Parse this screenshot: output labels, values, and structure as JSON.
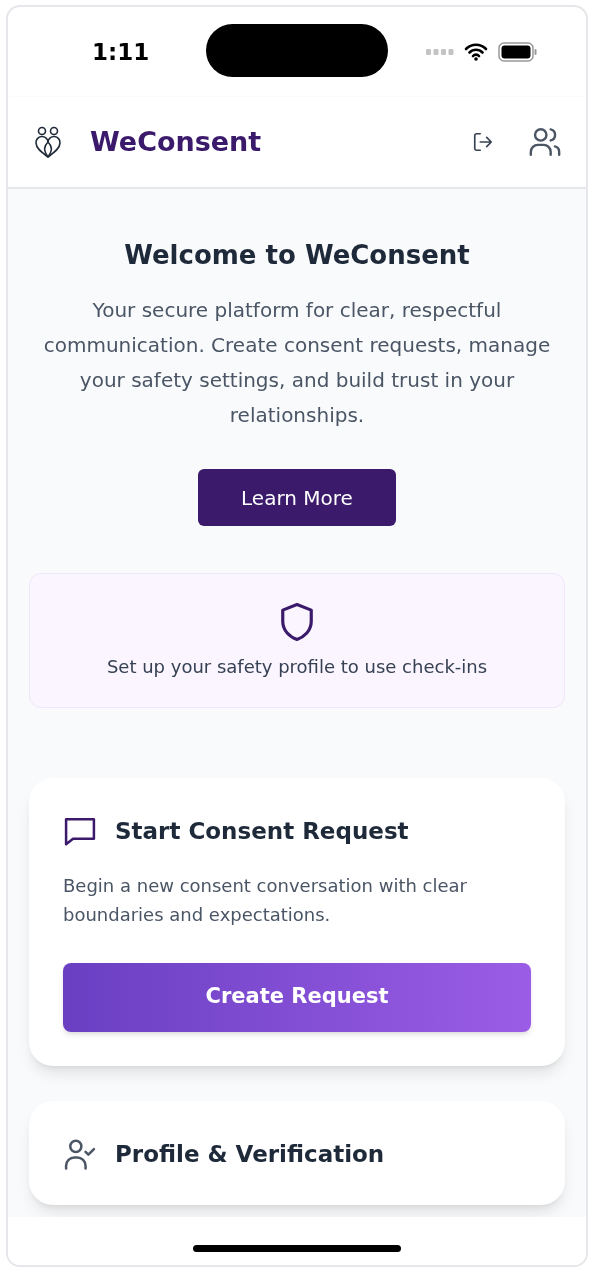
{
  "status_bar": {
    "time": "1:11"
  },
  "header": {
    "app_name": "WeConsent"
  },
  "welcome": {
    "title": "Welcome to WeConsent",
    "text": "Your secure platform for clear, respectful communication. Create consent requests, manage your safety settings, and build trust in your relationships.",
    "button": "Learn More"
  },
  "safety_notice": {
    "text": "Set up your safety profile to use check-ins"
  },
  "cards": [
    {
      "kind": "consent",
      "title": "Start Consent Request",
      "description": "Begin a new consent conversation with clear boundaries and expectations.",
      "button": "Create Request"
    },
    {
      "kind": "profile",
      "title": "Profile & Verification"
    }
  ]
}
